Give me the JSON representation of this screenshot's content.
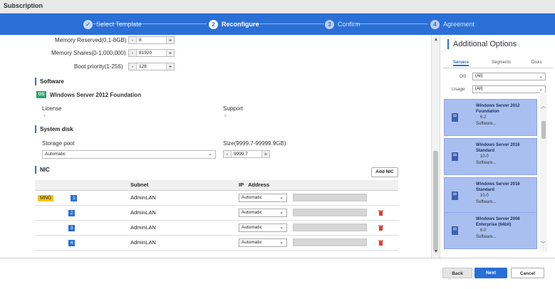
{
  "window": {
    "title": "Subscription"
  },
  "wizard": {
    "steps": [
      {
        "num": "✓",
        "label": "Select Template"
      },
      {
        "num": "2",
        "label": "Reconfigure"
      },
      {
        "num": "3",
        "label": "Confirm"
      },
      {
        "num": "4",
        "label": "Agreement"
      }
    ]
  },
  "vm": {
    "memory_reserved_label": "Memory Reserved(0.1-8GB)",
    "memory_reserved_value": "8",
    "memory_shares_label": "Memory Shares(0-1,000,000)",
    "memory_shares_value": "81920",
    "boot_priority_label": "Boot priority(1-256)",
    "boot_priority_value": "128",
    "minus": "-",
    "plus": "+"
  },
  "software": {
    "section": "Software",
    "badge": "OS",
    "name": "Windows Server 2012 Foundation",
    "license_label": "License",
    "license_value": "-",
    "support_label": "Support",
    "support_value": "-"
  },
  "system_disk": {
    "section": "System disk",
    "pool_label": "Storage pool",
    "pool_value": "Automatic",
    "size_label": "Size(9999.7-99999.9GB)",
    "size_value": "9999.7"
  },
  "nic": {
    "section": "NIC",
    "add_button": "Add NIC",
    "columns": [
      "",
      "Subnet",
      "IP",
      "Address"
    ],
    "rows": [
      {
        "tag": "MNG",
        "num": "1",
        "subnet": "AdminLAN",
        "ip": "Automatic"
      },
      {
        "tag": "",
        "num": "2",
        "subnet": "AdminLAN",
        "ip": "Automatic"
      },
      {
        "tag": "",
        "num": "3",
        "subnet": "AdminLAN",
        "ip": "Automatic"
      },
      {
        "tag": "",
        "num": "4",
        "subnet": "AdminLAN",
        "ip": "Automatic"
      }
    ]
  },
  "sidebar": {
    "title": "Additional Options",
    "tabs": [
      "Servers",
      "Segments",
      "Disks"
    ],
    "os_label": "OS",
    "os_value": "(All)",
    "usage_label": "Usage",
    "usage_value": "(All)",
    "cards": [
      {
        "name": "Windows Server 2012 Foundation",
        "version": "6.2",
        "category": "Software..."
      },
      {
        "name": "Windows Server 2016 Standard",
        "version": "10.0",
        "category": "Software..."
      },
      {
        "name": "Windows Server 2016 Standard",
        "version": "10.0",
        "category": "Software..."
      },
      {
        "name": "Windows Server 2008 Enterprise (64bit)",
        "version": "6.0",
        "category": "Software..."
      }
    ]
  },
  "footer": {
    "back": "Back",
    "next": "Next",
    "cancel": "Cancel"
  },
  "colors": {
    "accent": "#2a6fd6",
    "badge_os": "#2ca36d",
    "tag_mng": "#f5c518",
    "card_bg": "#a9bff0",
    "trash": "#e03a2f"
  }
}
